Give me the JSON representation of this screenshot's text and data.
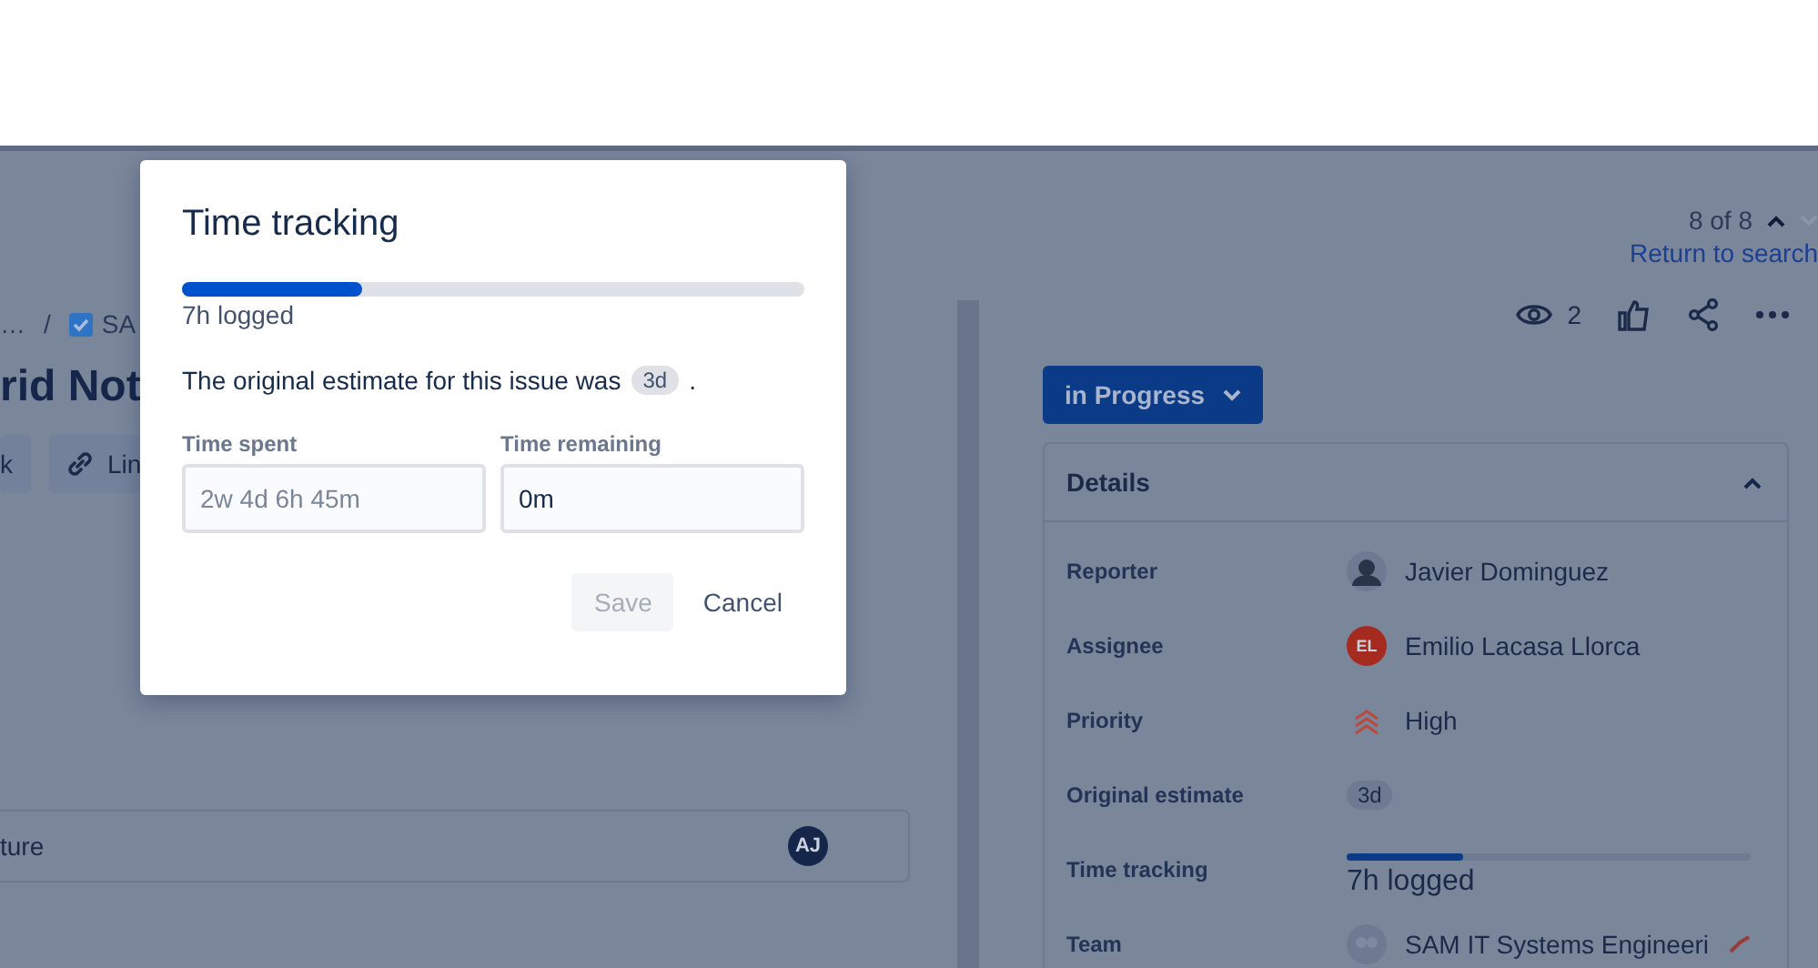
{
  "issue": {
    "breadcrumb": [
      "…",
      "/",
      "SA"
    ],
    "title": "rid Not",
    "actions": [
      {
        "kind": "plain",
        "label": "k"
      },
      {
        "kind": "link",
        "label": "Lin"
      }
    ],
    "child_item": {
      "label": "ture",
      "avatar": "AJ"
    }
  },
  "navigation": {
    "position": "8 of 8",
    "return_link": "Return to search"
  },
  "toolbar": {
    "watchers": "2"
  },
  "status": {
    "label": "in Progress"
  },
  "details": {
    "title": "Details",
    "expanded": true,
    "rows": [
      {
        "kind": "person",
        "label": "Reporter",
        "value": "Javier Dominguez",
        "avatar": ""
      },
      {
        "kind": "person",
        "label": "Assignee",
        "value": "Emilio Lacasa Llorca",
        "avatar": "EL",
        "color": "#a52a1f"
      },
      {
        "kind": "priority",
        "label": "Priority",
        "value": "High"
      },
      {
        "kind": "badge",
        "label": "Original estimate",
        "value": "3d"
      },
      {
        "kind": "progress",
        "label": "Time tracking",
        "value": "7h logged",
        "level": 0.29
      },
      {
        "kind": "team",
        "label": "Team",
        "value": "SAM IT Systems Engineeri"
      }
    ]
  },
  "dialog": {
    "title": "Time tracking",
    "level": 0.29,
    "logged": "7h logged",
    "estimate_text": "The original estimate for this issue was",
    "estimate_badge": "3d",
    "estimate_end": ".",
    "fields": [
      {
        "label": "Time spent",
        "placeholder": "2w 4d 6h 45m"
      },
      {
        "label": "Time remaining",
        "value": "0m"
      }
    ],
    "buttons": [
      {
        "kind": "save",
        "label": "Save",
        "disabled": true
      },
      {
        "kind": "cancel",
        "label": "Cancel",
        "disabled": false
      }
    ]
  }
}
